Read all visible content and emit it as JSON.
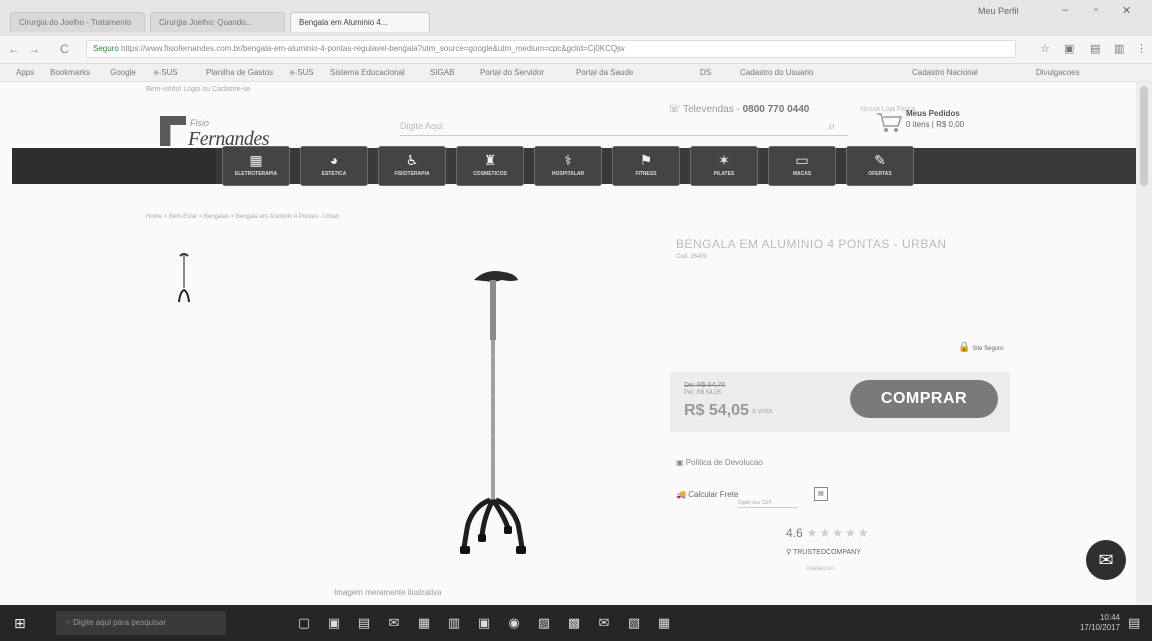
{
  "browser": {
    "tabs": [
      {
        "label": "Cirurgia do Joelho - Tratamento"
      },
      {
        "label": "Cirurgia Joelho: Quando..."
      },
      {
        "label": "Bengala em Aluminio 4..."
      }
    ],
    "user": "Meu Perfil",
    "url_secure": "Seguro",
    "url": "https://www.fisiofernandes.com.br/bengala-em-aluminio-4-pontas-regulavel-bengala?utm_source=google&utm_medium=cpc&gclid=Cj0KCQjw",
    "bookmarks": [
      "Apps",
      "Bookmarks",
      "Google",
      "e-SUS",
      "Planilha de Gastos",
      "e-SUS",
      "Sistema Educacional",
      "SIGAB",
      "Portal do Servidor",
      "Portal da Saude",
      "DS",
      "Cadastro do Usuario",
      "Cadastro Nacional",
      "Divulgacoes"
    ]
  },
  "site": {
    "register": "Bem-vindo! Login ou Cadastre-se",
    "televendas_label": "Televendas - ",
    "phone": "0800 770 0440",
    "loja_fisica": "Nossa Loja Fisica",
    "logo_small": "Fisio",
    "logo_text": "Fernandes",
    "search_placeholder": "Digite Aqui",
    "cart_title": "Meus Pedidos",
    "cart_sub": "0 itens | R$ 0,00"
  },
  "categories": [
    {
      "label": "Eletroterapia",
      "icon": "calculator-icon",
      "glyph": "▦"
    },
    {
      "label": "Estetica",
      "icon": "face-icon",
      "glyph": "◕"
    },
    {
      "label": "Fisioterapia",
      "icon": "therapy-icon",
      "glyph": "♿"
    },
    {
      "label": "Cosmeticos",
      "icon": "bottles-icon",
      "glyph": "♜"
    },
    {
      "label": "Hospitalar",
      "icon": "stethoscope-icon",
      "glyph": "⚕"
    },
    {
      "label": "Fitness",
      "icon": "treadmill-icon",
      "glyph": "⚑"
    },
    {
      "label": "Pilates",
      "icon": "pilates-icon",
      "glyph": "✶"
    },
    {
      "label": "Macas",
      "icon": "bed-icon",
      "glyph": "▭"
    },
    {
      "label": "Ofertas",
      "icon": "tag-icon",
      "glyph": "✎"
    }
  ],
  "breadcrumb": "Home > Bem-Estar > Bengalas > Bengala em Aluminio 4 Pontas - Urban",
  "product": {
    "title": "BENGALA EM ALUMINIO 4 PONTAS - URBAN",
    "code": "Cod. 26400",
    "safe_label": "Site Seguro",
    "old_price": "De: R$ 64,70",
    "por": "Por: R$ 54,05",
    "price": "R$ 54,05",
    "avista": "a vista",
    "buy_label": "COMPRAR",
    "return_label": "Politica de Devolucao",
    "frete_label": "Calcular Frete",
    "frete_placeholder": "Digite seu CEP",
    "rating_value": "4.6",
    "stars": "★★★★★",
    "trusted": "TRUSTEDCOMPANY",
    "trusted_sub": "Avaliacoes",
    "image_note": "Imagem meramente ilustrativa"
  },
  "taskbar": {
    "search_placeholder": "Digite aqui para pesquisar",
    "time": "10:44",
    "date": "17/10/2017"
  }
}
